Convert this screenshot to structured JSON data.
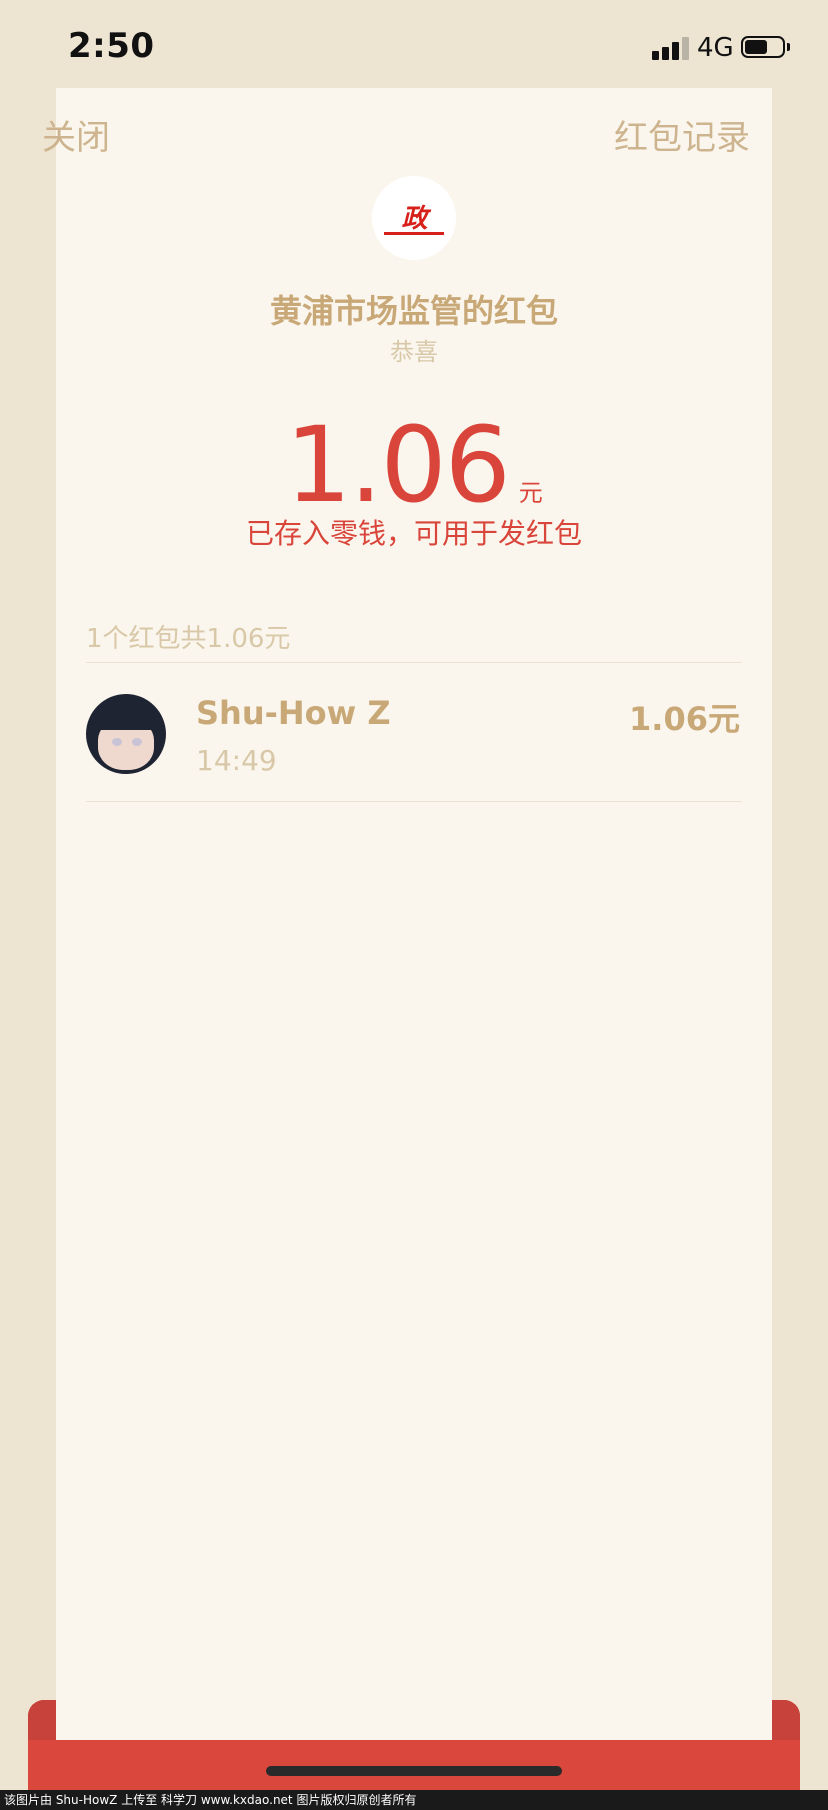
{
  "status_bar": {
    "time": "2:50",
    "network": "4G",
    "signal_bars_active": 3,
    "signal_bars_total": 4,
    "battery_level": 0.6
  },
  "nav": {
    "close_label": "关闭",
    "records_label": "红包记录"
  },
  "logo": {
    "mark_text": "政"
  },
  "red_packet": {
    "sender_title": "黄浦市场监管的红包",
    "greeting": "恭喜",
    "amount": "1.06",
    "amount_unit": "元",
    "deposit_note": "已存入零钱，可用于发红包"
  },
  "summary": "1个红包共1.06元",
  "receivers": [
    {
      "name": "Shu-How Z",
      "time": "14:49",
      "amount": "1.06元"
    }
  ],
  "watermark": "该图片由 Shu-HowZ 上传至 科学刀 www.kxdao.net 图片版权归原创者所有",
  "colors": {
    "background": "#ede4d2",
    "card": "#faf6ed",
    "gold_text": "#c9a878",
    "light_gold_text": "#d8c8a8",
    "accent_red": "#d9453a",
    "envelope_red": "#d9473d"
  }
}
